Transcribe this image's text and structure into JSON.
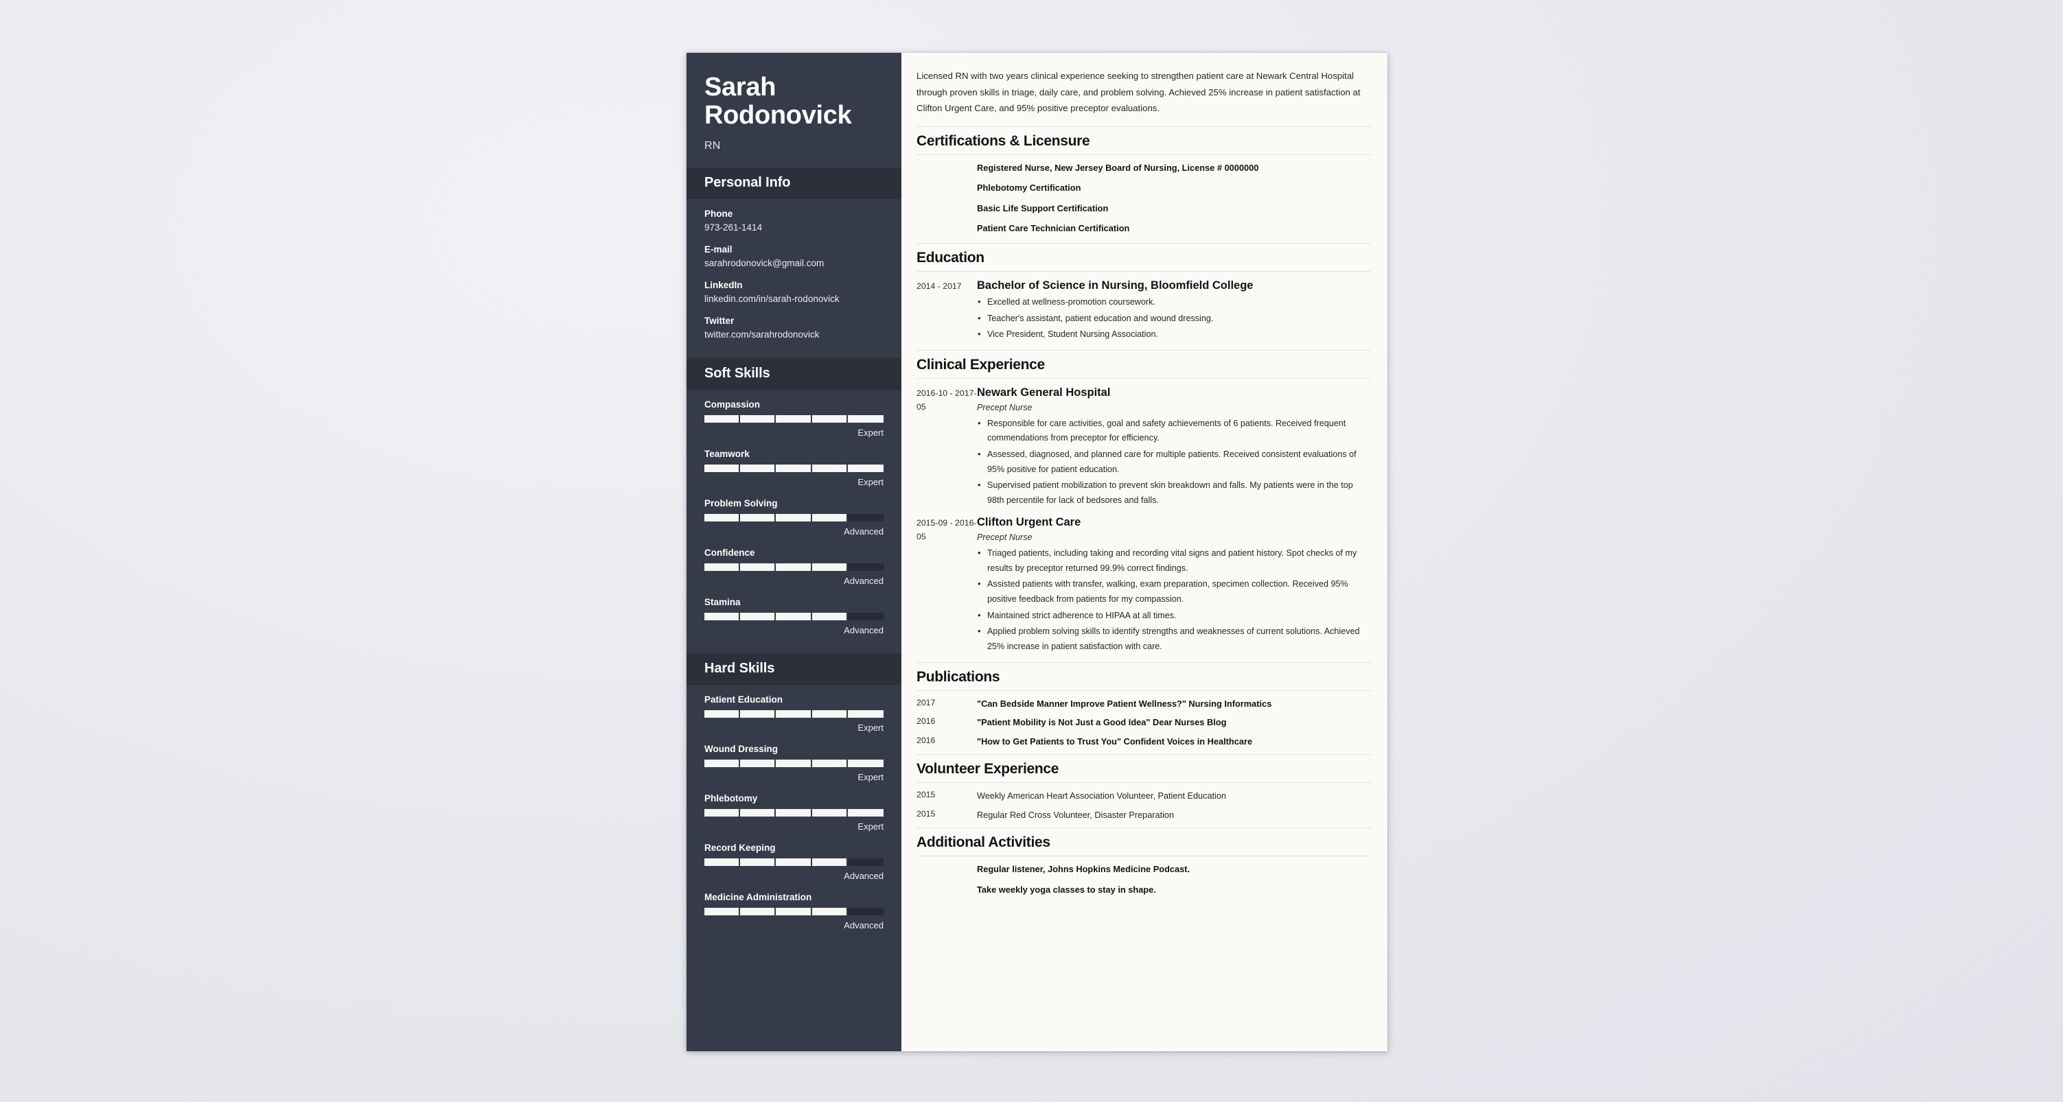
{
  "sidebar": {
    "name": "Sarah Rodonovick",
    "title": "RN",
    "personal_info": {
      "heading": "Personal Info",
      "fields": [
        {
          "label": "Phone",
          "value": "973-261-1414"
        },
        {
          "label": "E-mail",
          "value": "sarahrodonovick@gmail.com"
        },
        {
          "label": "LinkedIn",
          "value": "linkedin.com/in/sarah-rodonovick"
        },
        {
          "label": "Twitter",
          "value": "twitter.com/sarahrodonovick"
        }
      ]
    },
    "soft_skills": {
      "heading": "Soft Skills",
      "items": [
        {
          "name": "Compassion",
          "level": "Expert",
          "percent": 100
        },
        {
          "name": "Teamwork",
          "level": "Expert",
          "percent": 100
        },
        {
          "name": "Problem Solving",
          "level": "Advanced",
          "percent": 80
        },
        {
          "name": "Confidence",
          "level": "Advanced",
          "percent": 80
        },
        {
          "name": "Stamina",
          "level": "Advanced",
          "percent": 80
        }
      ]
    },
    "hard_skills": {
      "heading": "Hard Skills",
      "items": [
        {
          "name": "Patient Education",
          "level": "Expert",
          "percent": 100
        },
        {
          "name": "Wound Dressing",
          "level": "Expert",
          "percent": 100
        },
        {
          "name": "Phlebotomy",
          "level": "Expert",
          "percent": 100
        },
        {
          "name": "Record Keeping",
          "level": "Advanced",
          "percent": 80
        },
        {
          "name": "Medicine Administration",
          "level": "Advanced",
          "percent": 80
        }
      ]
    }
  },
  "main": {
    "summary": "Licensed RN with two years clinical experience seeking to strengthen patient care at Newark Central Hospital through proven skills in triage, daily care, and problem solving. Achieved 25% increase in patient satisfaction at Clifton Urgent Care, and 95% positive preceptor evaluations.",
    "certifications": {
      "heading": "Certifications & Licensure",
      "items": [
        "Registered Nurse, New Jersey Board of Nursing, License # 0000000",
        "Phlebotomy Certification",
        "Basic Life Support Certification",
        "Patient Care Technician Certification"
      ]
    },
    "education": {
      "heading": "Education",
      "entries": [
        {
          "date": "2014 - 2017",
          "title": "Bachelor of Science in Nursing, Bloomfield College",
          "bullets": [
            "Excelled at wellness-promotion coursework.",
            "Teacher's assistant, patient education and wound dressing.",
            "Vice President, Student Nursing Association."
          ]
        }
      ]
    },
    "clinical_experience": {
      "heading": "Clinical Experience",
      "entries": [
        {
          "date": "2016-10 - 2017-05",
          "title": "Newark General Hospital",
          "subtitle": "Precept Nurse",
          "bullets": [
            "Responsible for care activities, goal and safety achievements of 6 patients. Received frequent commendations from preceptor for efficiency.",
            "Assessed, diagnosed, and planned care for multiple patients. Received consistent evaluations of 95% positive for patient education.",
            "Supervised patient mobilization to prevent skin breakdown and falls. My patients were in the top 98th percentile for lack of bedsores and falls."
          ]
        },
        {
          "date": "2015-09 - 2016-05",
          "title": "Clifton Urgent Care",
          "subtitle": "Precept Nurse",
          "bullets": [
            "Triaged patients, including taking and recording vital signs and patient history. Spot checks of my results by preceptor returned 99.9% correct findings.",
            "Assisted patients with transfer, walking, exam preparation, specimen collection. Received 95% positive feedback from patients for my compassion.",
            "Maintained strict adherence to HIPAA at all times.",
            "Applied problem solving skills to identify strengths and weaknesses of current solutions. Achieved 25% increase in patient satisfaction with care."
          ]
        }
      ]
    },
    "publications": {
      "heading": "Publications",
      "entries": [
        {
          "date": "2017",
          "text": "\"Can Bedside Manner Improve Patient Wellness?\" Nursing Informatics"
        },
        {
          "date": "2016",
          "text": "\"Patient Mobility is Not Just a Good Idea\" Dear Nurses Blog"
        },
        {
          "date": "2016",
          "text": "\"How to Get Patients to Trust You\" Confident Voices in Healthcare"
        }
      ]
    },
    "volunteer": {
      "heading": "Volunteer Experience",
      "entries": [
        {
          "date": "2015",
          "text": "Weekly American Heart Association Volunteer, Patient Education"
        },
        {
          "date": "2015",
          "text": "Regular Red Cross Volunteer, Disaster Preparation"
        }
      ]
    },
    "additional": {
      "heading": "Additional Activities",
      "items": [
        "Regular listener, Johns Hopkins Medicine Podcast.",
        "Take weekly yoga classes to stay in shape."
      ]
    }
  }
}
